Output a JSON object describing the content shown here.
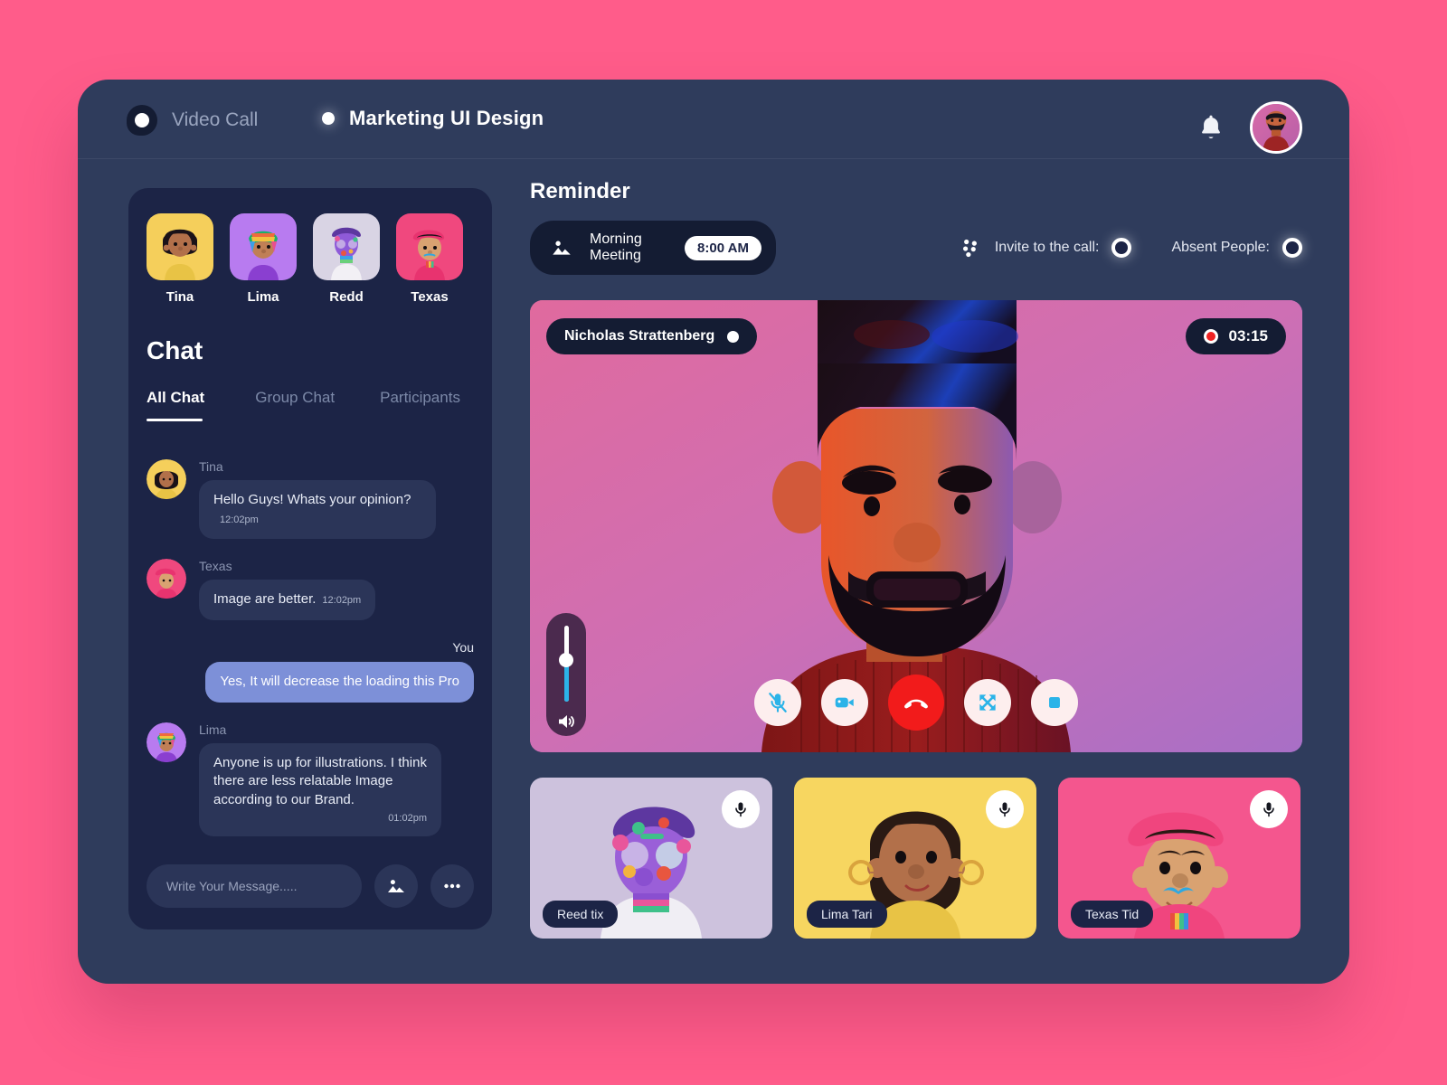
{
  "brand": {
    "label": "Video Call",
    "mark_icon": "app-logo-icon"
  },
  "project": {
    "title": "Marketing UI Design"
  },
  "topbar": {
    "bell_icon": "bell-icon",
    "avatar_icon": "user-avatar"
  },
  "chat": {
    "people": [
      {
        "name": "Tina",
        "bg": "#f5cf5b"
      },
      {
        "name": "Lima",
        "bg": "#b87bf0"
      },
      {
        "name": "Redd",
        "bg": "#d9d4e4"
      },
      {
        "name": "Texas",
        "bg": "#f0487e"
      }
    ],
    "title": "Chat",
    "tabs": [
      {
        "label": "All Chat",
        "active": true
      },
      {
        "label": "Group Chat",
        "active": false
      },
      {
        "label": "Participants",
        "active": false
      }
    ],
    "messages": [
      {
        "sender": "Tina",
        "text": "Hello Guys! Whats your opinion?",
        "time": "12:02pm",
        "self": false
      },
      {
        "sender": "Texas",
        "text": "Image are better.",
        "time": "12:02pm",
        "self": false
      },
      {
        "sender": "You",
        "text": "Yes, It will decrease the loading this Pro",
        "time": "",
        "self": true
      },
      {
        "sender": "Lima",
        "text": "Anyone is up for illustrations. I think there are less relatable Image according to our Brand.",
        "time": "01:02pm",
        "self": false
      }
    ],
    "composer": {
      "placeholder": "Write Your Message.....",
      "value": "",
      "image_icon": "image-icon",
      "more_icon": "more-options-icon"
    }
  },
  "reminder": {
    "heading": "Reminder",
    "item_icon": "image-icon",
    "item_title": "Morning Meeting",
    "item_time": "8:00 AM"
  },
  "call_actions": {
    "grid_icon": "grid-dots-icon",
    "invite_label": "Invite to the call:",
    "absent_label": "Absent People:"
  },
  "stage": {
    "speaker_name": "Nicholas Strattenberg",
    "timer": "03:15",
    "record_color": "#f02222",
    "volume_percent": 55,
    "volume_icon": "speaker-icon",
    "controls": [
      {
        "name": "mic-muted-button",
        "icon": "mic-off-icon",
        "style": "light"
      },
      {
        "name": "video-button",
        "icon": "video-icon",
        "style": "light"
      },
      {
        "name": "end-call-button",
        "icon": "hangup-icon",
        "style": "end"
      },
      {
        "name": "fullscreen-button",
        "icon": "expand-icon",
        "style": "light"
      },
      {
        "name": "stop-share-button",
        "icon": "stop-square-icon",
        "style": "light"
      }
    ]
  },
  "thumbnails": [
    {
      "name": "Reed tix",
      "bg": "#cdc2dd",
      "mic_icon": "mic-icon"
    },
    {
      "name": "Lima Tari",
      "bg": "#f7d660",
      "mic_icon": "mic-icon"
    },
    {
      "name": "Texas Tid",
      "bg": "#f4568e",
      "mic_icon": "mic-icon"
    }
  ],
  "colors": {
    "page_bg": "#ff5c8a",
    "app_bg": "#2f3c5c",
    "panel_bg": "#1c2446",
    "bubble_bg": "#2b3558",
    "self_bubble": "#7d90d8",
    "accent_blue": "#2bb3e8",
    "danger": "#f21b1b"
  }
}
